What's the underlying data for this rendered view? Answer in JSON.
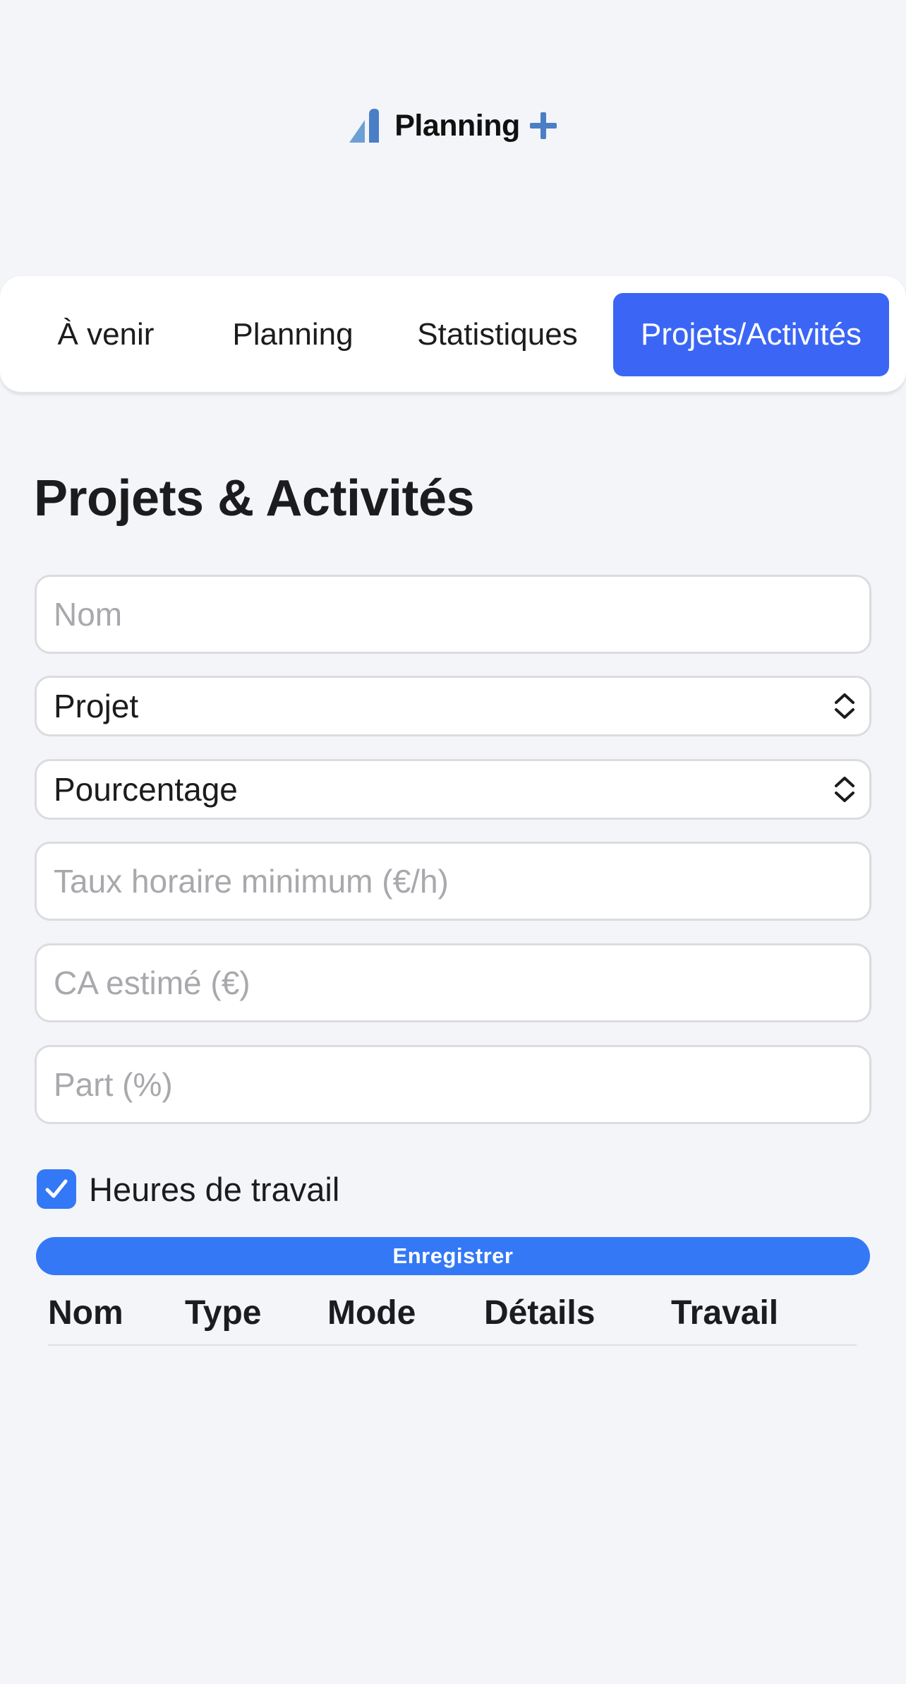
{
  "brand": {
    "name": "Planning",
    "logo_icon": "bar-chart-icon",
    "plus_icon": "plus-icon",
    "accent_color": "#3b66f5",
    "logo_colors": [
      "#6d9fd4",
      "#4a7fc6"
    ]
  },
  "tabs": [
    {
      "label": "À venir",
      "active": false
    },
    {
      "label": "Planning",
      "active": false
    },
    {
      "label": "Statistiques",
      "active": false
    },
    {
      "label": "Projets/Activités",
      "active": true
    }
  ],
  "page": {
    "title": "Projets & Activités"
  },
  "form": {
    "name_placeholder": "Nom",
    "type_select": {
      "value": "Projet",
      "icon": "chevron-up-down-icon"
    },
    "mode_select": {
      "value": "Pourcentage",
      "icon": "chevron-up-down-icon"
    },
    "min_rate_placeholder": "Taux horaire minimum (€/h)",
    "estimated_revenue_placeholder": "CA estimé (€)",
    "share_placeholder": "Part (%)",
    "work_hours_checkbox": {
      "label": "Heures de travail",
      "checked": true
    },
    "save_label": "Enregistrer",
    "save_color": "#3478f6"
  },
  "table": {
    "columns": [
      "Nom",
      "Type",
      "Mode",
      "Détails",
      "Travail"
    ],
    "rows": []
  }
}
